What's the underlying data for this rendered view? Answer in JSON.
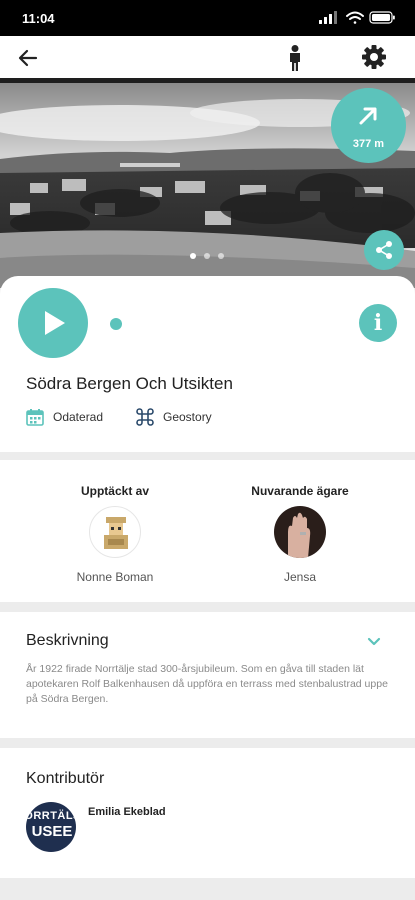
{
  "status_bar": {
    "time": "11:04"
  },
  "distance": "377 m",
  "site": {
    "title": "Södra Bergen Och Utsikten",
    "date_label": "Odaterad",
    "type_label": "Geostory"
  },
  "discovered": {
    "heading": "Upptäckt av",
    "name": "Nonne Boman"
  },
  "owner": {
    "heading": "Nuvarande ägare",
    "name": "Jensa"
  },
  "description": {
    "heading": "Beskrivning",
    "text": "År 1922 firade Norrtälje stad 300-årsjubileum. Som en gåva till staden lät apotekaren Rolf Balkenhausen då uppföra en terrass med stenbalustrad uppe på Södra Bergen."
  },
  "contributor": {
    "heading": "Kontributör",
    "name": "Emilia Ekeblad",
    "logo_line1": "ORRTÄLJ",
    "logo_line2": "USEE"
  },
  "colors": {
    "accent": "#5cc3bb",
    "dark": "#1e1e1e"
  }
}
